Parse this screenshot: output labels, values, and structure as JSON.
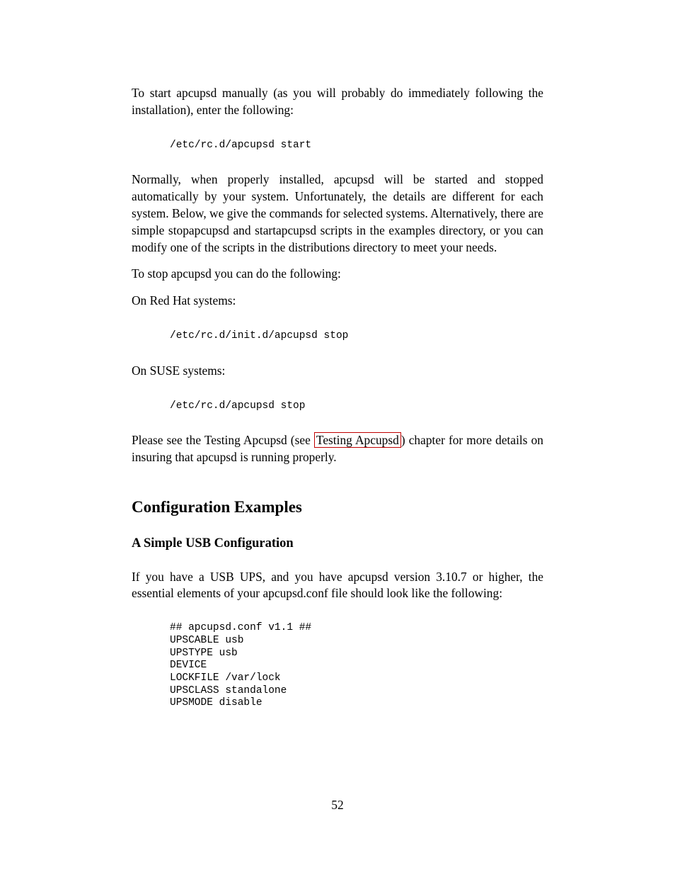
{
  "p1": "To start apcupsd manually (as you will probably do immediately following the installation), enter the following:",
  "code1": "/etc/rc.d/apcupsd start",
  "p2": "Normally, when properly installed, apcupsd will be started and stopped automatically by your system. Unfortunately, the details are different for each system. Below, we give the commands for selected systems. Alternatively, there are simple stopapcupsd and startapcupsd scripts in the examples directory, or you can modify one of the scripts in the distributions directory to meet your needs.",
  "p3": "To stop apcupsd you can do the following:",
  "p4": "On Red Hat systems:",
  "code2": "/etc/rc.d/init.d/apcupsd stop",
  "p5": "On SUSE systems:",
  "code3": "/etc/rc.d/apcupsd stop",
  "p6a": "Please see the Testing Apcupsd (see ",
  "link1": "Testing Apcupsd",
  "p6b": ") chapter for more details on insuring that apcupsd is running properly.",
  "h_section": "Configuration Examples",
  "h_sub": "A Simple USB Configuration",
  "p7": "If you have a USB UPS, and you have apcupsd version 3.10.7 or higher, the essential elements of your apcupsd.conf file should look like the following:",
  "code4": "## apcupsd.conf v1.1 ##\nUPSCABLE usb\nUPSTYPE usb\nDEVICE\nLOCKFILE /var/lock\nUPSCLASS standalone\nUPSMODE disable",
  "page_number": "52"
}
